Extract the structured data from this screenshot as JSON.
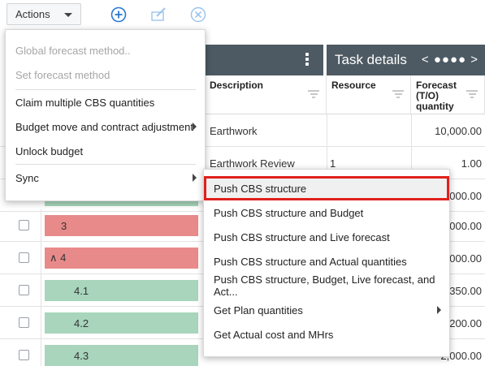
{
  "toolbar": {
    "actions_label": "Actions",
    "icons": [
      "add-circle-icon",
      "edit-icon",
      "cancel-circle-icon"
    ],
    "accent": "#2b78d6"
  },
  "panels": {
    "right_title": "Task details",
    "right_nav": "< ●●●● >"
  },
  "columns": {
    "description": "Description",
    "resource": "Resource",
    "forecast": "Forecast (T/O) quantity"
  },
  "rows": [
    {
      "description": "Earthwork",
      "resource": "",
      "forecast": "10,000.00"
    },
    {
      "description": "Earthwork Review",
      "resource": "1",
      "forecast": "1.00"
    },
    {
      "wbs": "",
      "forecast": "0,000.00"
    },
    {
      "wbs": "3",
      "forecast": "0,000.00"
    },
    {
      "wbs": "∧ 4",
      "forecast": ",000.00"
    },
    {
      "wbs": "4.1",
      "forecast": "350.00"
    },
    {
      "wbs": "4.2",
      "forecast": "200.00"
    },
    {
      "wbs": "4.3",
      "forecast": "2,000.00"
    }
  ],
  "actions_menu": {
    "items": [
      {
        "label": "Global forecast method..",
        "disabled": true
      },
      {
        "label": "Set forecast method",
        "disabled": true
      },
      {
        "label": "Claim multiple CBS quantities",
        "disabled": false
      },
      {
        "label": "Budget move and contract adjustment",
        "disabled": false,
        "submenu": true
      },
      {
        "label": "Unlock budget",
        "disabled": false
      },
      {
        "label": "Sync",
        "disabled": false,
        "submenu": true
      }
    ]
  },
  "sync_menu": {
    "items": [
      {
        "label": "Push CBS structure",
        "highlighted": true
      },
      {
        "label": "Push CBS structure and Budget"
      },
      {
        "label": "Push CBS structure and Live forecast"
      },
      {
        "label": "Push CBS structure and Actual quantities"
      },
      {
        "label": "Push CBS structure, Budget, Live forecast, and Act..."
      },
      {
        "label": "Get Plan quantities",
        "submenu": true
      },
      {
        "label": "Get Actual cost and MHrs"
      }
    ]
  },
  "colors": {
    "header_bg": "#4d5a63",
    "wbs_red": "#e88a8a",
    "wbs_green": "#a8d5bc",
    "highlight_border": "#e0201b"
  }
}
